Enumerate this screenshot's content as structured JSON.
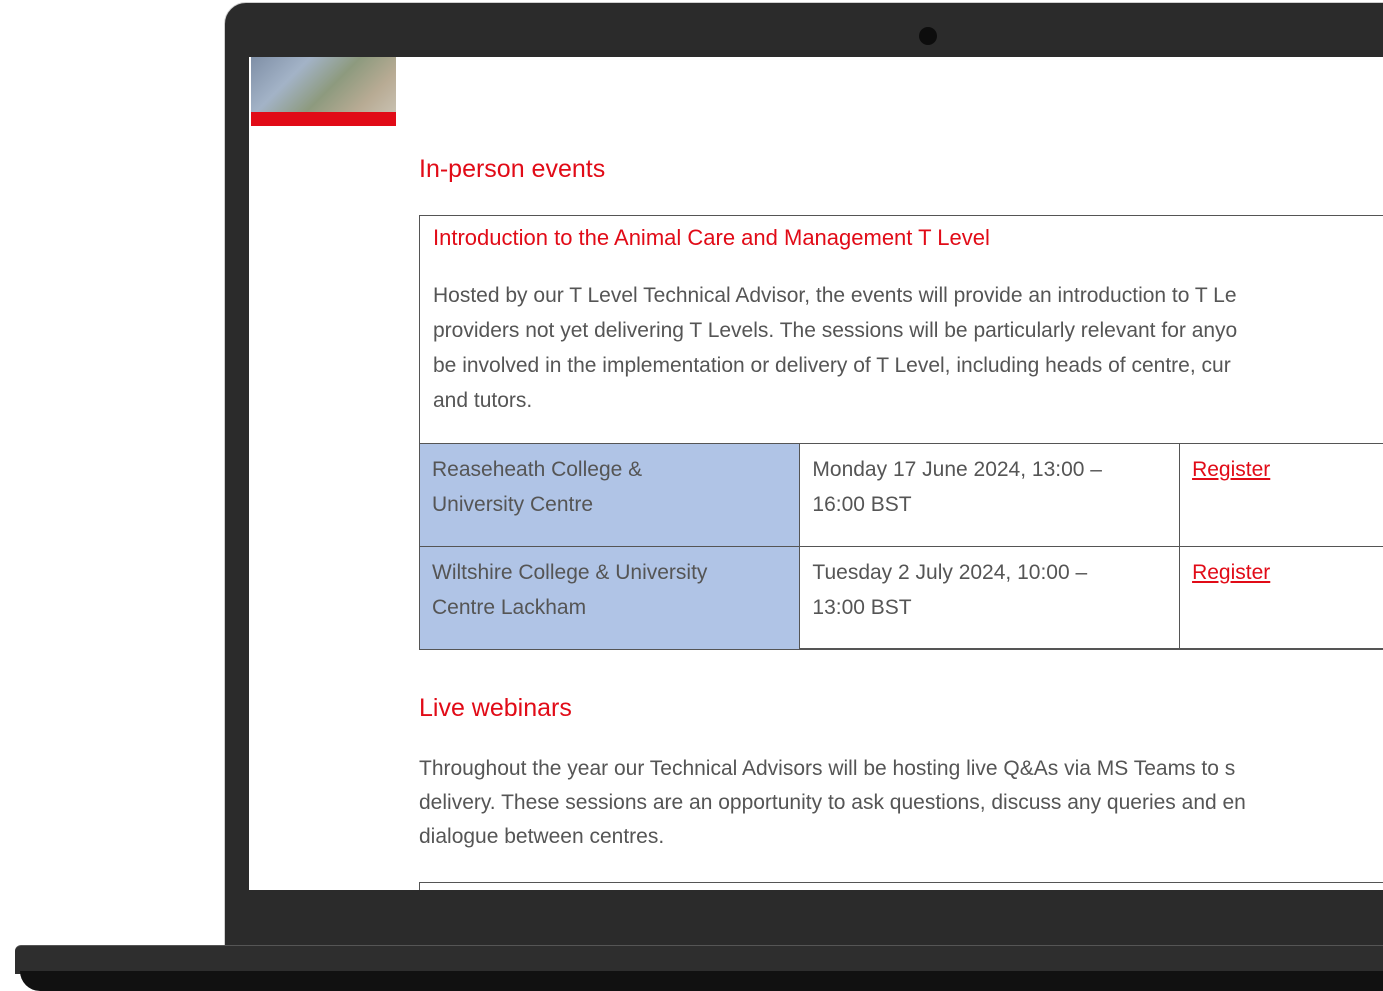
{
  "sections": {
    "in_person_heading": "In-person events",
    "webinars_heading": "Live webinars"
  },
  "event": {
    "title": "Introduction to the Animal Care and Management T Level",
    "description_lines": [
      "Hosted by our T Level Technical Advisor, the events will provide an introduction to T Le",
      "providers not yet delivering T Levels. The sessions will be particularly relevant for anyo",
      "be involved in the implementation or delivery of T Level, including heads of centre, cur",
      "and tutors."
    ],
    "rows": [
      {
        "venue_lines": [
          "Reaseheath College &",
          "University Centre"
        ],
        "date_lines": [
          "Monday 17 June 2024, 13:00 –",
          "16:00 BST"
        ],
        "register": "Register"
      },
      {
        "venue_lines": [
          "Wiltshire College & University",
          "Centre Lackham"
        ],
        "date_lines": [
          "Tuesday 2 July 2024, 10:00 –",
          "13:00 BST"
        ],
        "register": "Register"
      }
    ]
  },
  "webinars": {
    "intro_lines": [
      "Throughout the year our Technical Advisors will be hosting live Q&As via MS Teams to s",
      "delivery. These sessions are an opportunity to ask questions, discuss any queries and en",
      "dialogue between centres."
    ]
  },
  "colors": {
    "accent": "#e10b17",
    "venue_cell": "#b0c4e6",
    "body_text": "#555555",
    "device_frame": "#2b2b2b"
  }
}
